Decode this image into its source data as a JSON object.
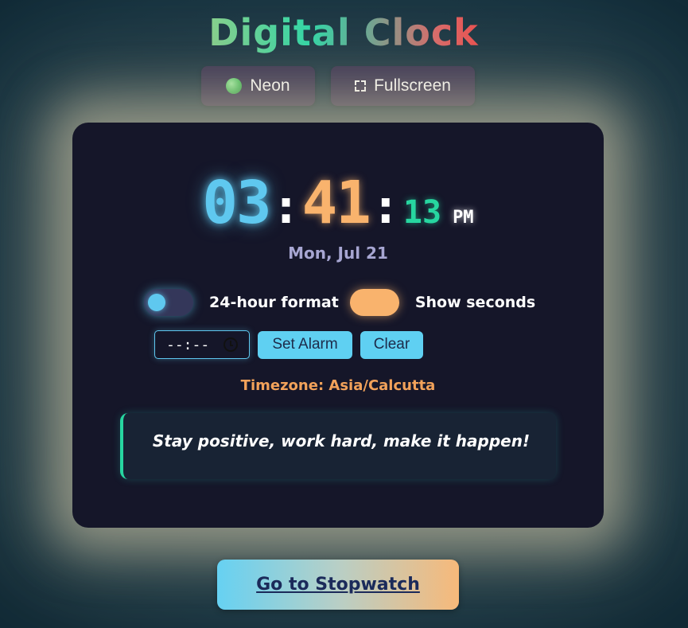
{
  "app": {
    "title": "Digital Clock"
  },
  "controls": {
    "theme_label": "Neon",
    "fullscreen_label": "Fullscreen"
  },
  "clock": {
    "hours": "03",
    "minutes": "41",
    "seconds": "13",
    "separator": ":",
    "ampm": "PM",
    "date": "Mon, Jul 21"
  },
  "settings": {
    "format_24h": {
      "label": "24-hour format",
      "enabled": false
    },
    "show_seconds": {
      "label": "Show seconds",
      "enabled": true
    }
  },
  "alarm": {
    "input_value": "--:--",
    "set_label": "Set Alarm",
    "clear_label": "Clear"
  },
  "timezone": "Timezone: Asia/Calcutta",
  "quote": "Stay positive, work hard, make it happen!",
  "nav": {
    "stopwatch_label": "Go to Stopwatch"
  },
  "colors": {
    "hours": "#5fc8ef",
    "minutes": "#f9b36d",
    "seconds": "#27d6a0",
    "card_bg": "#151629",
    "timezone": "#f2a25a"
  },
  "icons": {
    "theme": "green-dot-icon",
    "fullscreen": "fullscreen-icon",
    "time_input": "clock-icon"
  }
}
